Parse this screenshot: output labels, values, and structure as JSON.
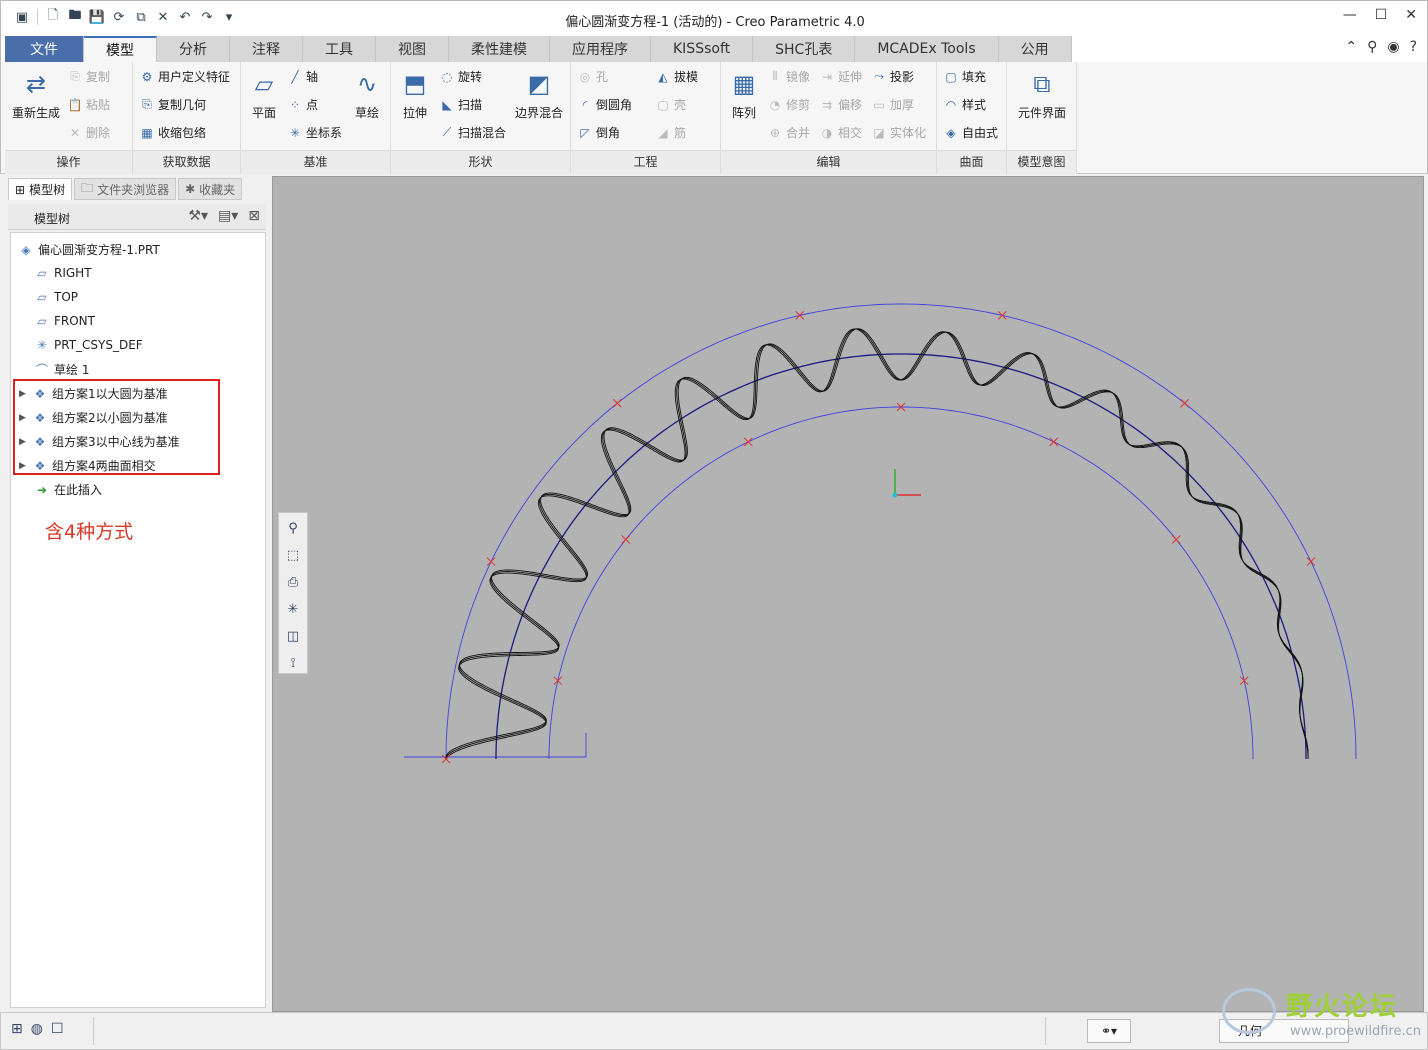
{
  "window": {
    "title": "偏心圆渐变方程-1 (活动的) - Creo Parametric 4.0"
  },
  "tabs": [
    "文件",
    "模型",
    "分析",
    "注释",
    "工具",
    "视图",
    "柔性建模",
    "应用程序",
    "KISSsoft",
    "SHC孔表",
    "MCADEx Tools",
    "公用"
  ],
  "ribbon": {
    "ops": {
      "regen": "重新生成",
      "copy": "复制",
      "paste": "粘贴",
      "del": "删除",
      "label": "操作"
    },
    "getdata": {
      "udf": "用户定义特征",
      "copygeom": "复制几何",
      "shrink": "收缩包络",
      "label": "获取数据"
    },
    "datum": {
      "plane": "平面",
      "axis": "轴",
      "point": "点",
      "csys": "坐标系",
      "sketch": "草绘",
      "label": "基准"
    },
    "shape": {
      "extrude": "拉伸",
      "revolve": "旋转",
      "sweep": "扫描",
      "sweepblend": "扫描混合",
      "boundary": "边界混合",
      "label": "形状"
    },
    "eng": {
      "hole": "孔",
      "round": "倒圆角",
      "chamfer": "倒角",
      "draft": "拔模",
      "shell": "壳",
      "rib": "筋",
      "label": "工程"
    },
    "edit": {
      "pattern": "阵列",
      "mirror": "镜像",
      "trim": "修剪",
      "merge": "合并",
      "extend": "延伸",
      "offset": "偏移",
      "intersect": "相交",
      "project": "投影",
      "thicken": "加厚",
      "solidify": "实体化",
      "label": "编辑"
    },
    "surf": {
      "fill": "填充",
      "style": "样式",
      "freestyle": "自由式",
      "label": "曲面"
    },
    "intent": {
      "comp": "元件界面",
      "label": "模型意图"
    }
  },
  "panel": {
    "tabs": [
      "模型树",
      "文件夹浏览器",
      "收藏夹"
    ],
    "header": "模型树"
  },
  "tree": [
    {
      "label": "偏心圆渐变方程-1.PRT",
      "icon": "part-icon"
    },
    {
      "label": "RIGHT",
      "icon": "datum-plane-icon"
    },
    {
      "label": "TOP",
      "icon": "datum-plane-icon"
    },
    {
      "label": "FRONT",
      "icon": "datum-plane-icon"
    },
    {
      "label": "PRT_CSYS_DEF",
      "icon": "csys-icon"
    },
    {
      "label": "草绘 1",
      "icon": "sketch-icon"
    },
    {
      "label": "组方案1以大圆为基准",
      "icon": "group-icon"
    },
    {
      "label": "组方案2以小圆为基准",
      "icon": "group-icon"
    },
    {
      "label": "组方案3以中心线为基准",
      "icon": "group-icon"
    },
    {
      "label": "组方案4两曲面相交",
      "icon": "group-icon"
    },
    {
      "label": "在此插入",
      "icon": "insert-arrow-icon"
    }
  ],
  "note": "含4种方式",
  "status": {
    "filter": "几何"
  },
  "watermark": {
    "name": "野火论坛",
    "url": "www.proewildfire.cn"
  },
  "colors": {
    "file_tab": "#4a6ea9",
    "viewport": "#b3b3b3",
    "highlight": "#e02020",
    "note": "#d63a2a"
  }
}
